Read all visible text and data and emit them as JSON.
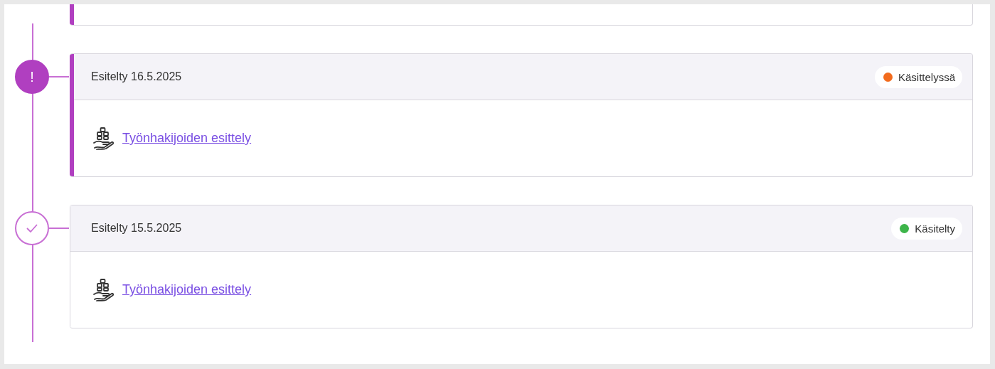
{
  "top_card": {
    "highlighted": true
  },
  "entries": [
    {
      "kind": "attention",
      "highlighted": true,
      "title": "Esitelty 16.5.2025",
      "status": {
        "label": "Käsittelyssä",
        "color": "#f26b1d"
      },
      "link": "Työnhakijoiden esittely",
      "marker": "!"
    },
    {
      "kind": "done",
      "highlighted": false,
      "title": "Esitelty 15.5.2025",
      "status": {
        "label": "Käsitelty",
        "color": "#3db54a"
      },
      "link": "Työnhakijoiden esittely"
    }
  ]
}
